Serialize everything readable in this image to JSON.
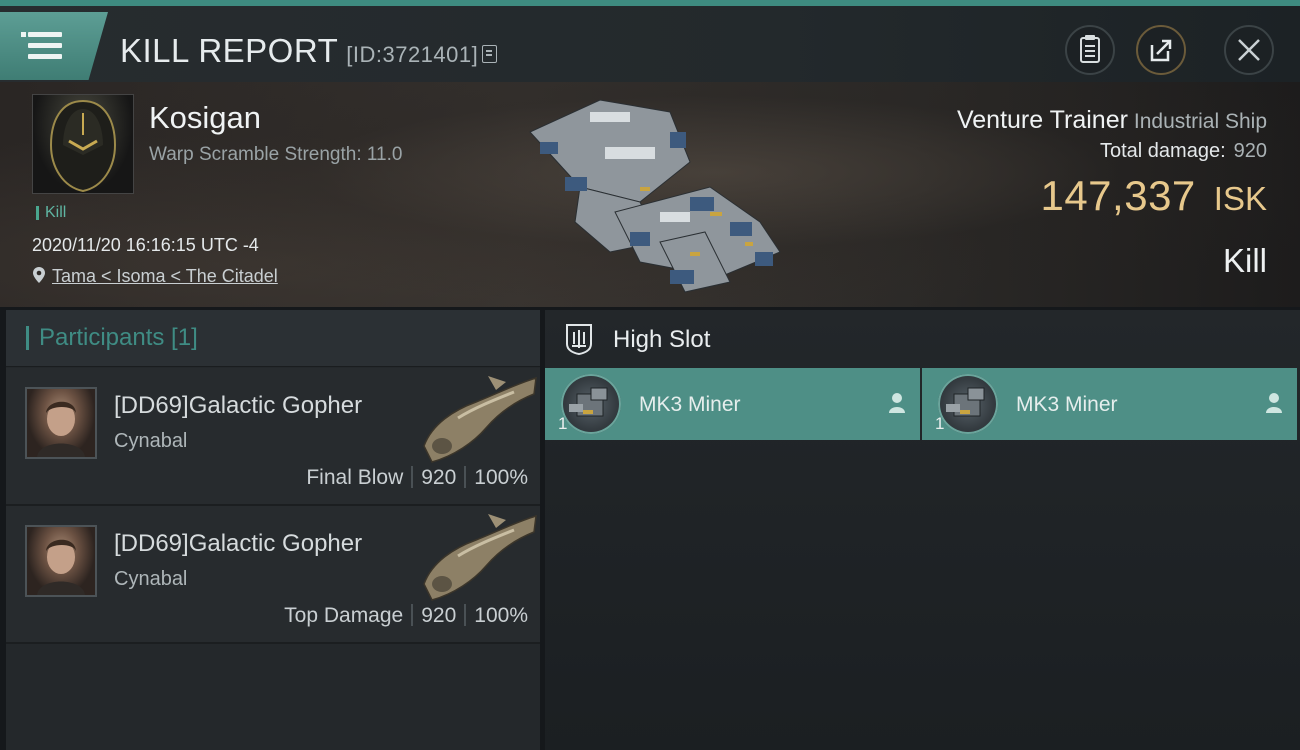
{
  "header": {
    "title": "KILL REPORT",
    "id_text": "[ID:3721401]"
  },
  "victim": {
    "name": "Kosigan",
    "warp_scramble": "Warp Scramble Strength: 11.0",
    "tag": "Kill",
    "datetime": "2020/11/20 16:16:15 UTC -4",
    "location": "Tama < Isoma < The Citadel"
  },
  "ship": {
    "name": "Venture Trainer",
    "class": "Industrial Ship",
    "total_damage_label": "Total damage:",
    "total_damage_value": "920",
    "isk_value": "147,337",
    "isk_unit": "ISK",
    "result": "Kill"
  },
  "participants": {
    "label": "Participants [1]",
    "rows": [
      {
        "name": "[DD69]Galactic Gopher",
        "ship": "Cynabal",
        "role": "Final Blow",
        "damage": "920",
        "percent": "100%"
      },
      {
        "name": "[DD69]Galactic Gopher",
        "ship": "Cynabal",
        "role": "Top Damage",
        "damage": "920",
        "percent": "100%"
      }
    ]
  },
  "slots": {
    "title": "High Slot",
    "modules": [
      {
        "name": "MK3 Miner",
        "qty": "1"
      },
      {
        "name": "MK3 Miner",
        "qty": "1"
      }
    ]
  },
  "colors": {
    "accent": "#4e8f86",
    "isk": "#e7c88c",
    "tag": "#5fb5a2"
  }
}
